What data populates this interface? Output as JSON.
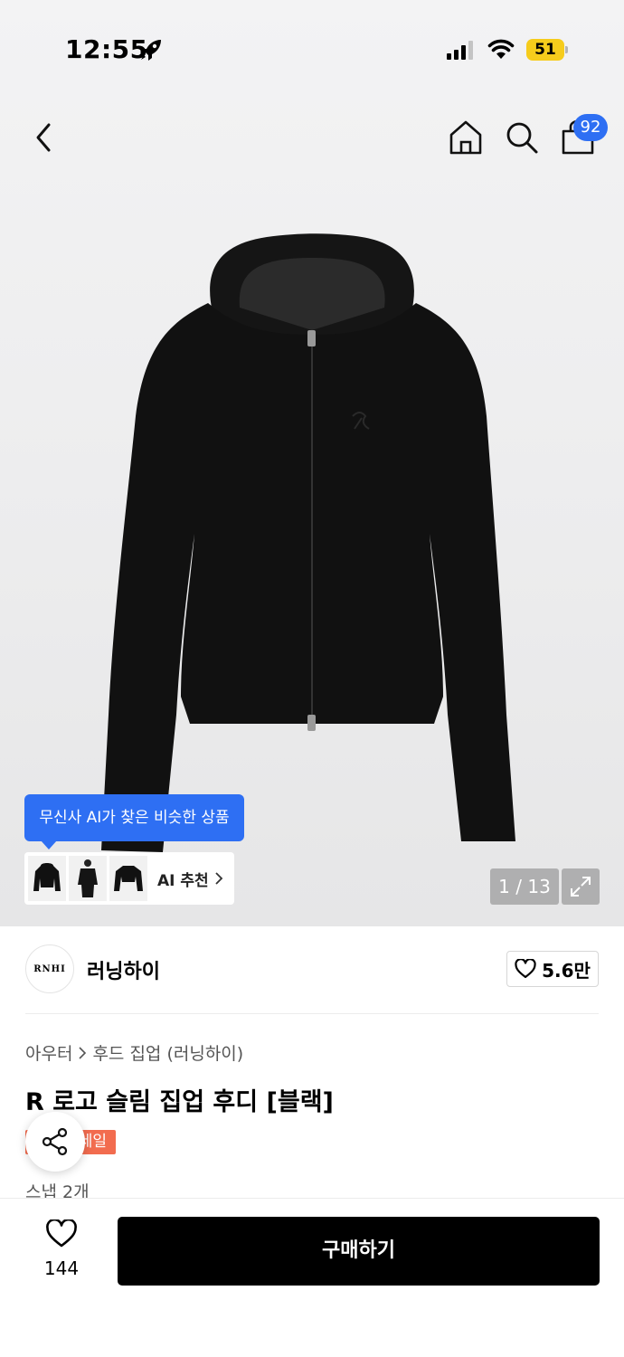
{
  "status_bar": {
    "time": "12:55",
    "battery": "51"
  },
  "nav": {
    "cart_count": "92"
  },
  "ai": {
    "tooltip": "무신사 AI가 찾은 비슷한 상품",
    "reco_label": "AI 추천"
  },
  "gallery": {
    "counter": "1 / 13"
  },
  "brand": {
    "logo_text": "RNHI",
    "name": "러닝하이",
    "likes": "5.6만"
  },
  "breadcrumb": {
    "category": "아우터",
    "subcategory": "후드 집업 (러닝하이)"
  },
  "product": {
    "title": "R 로고 슬림 집업 후디 [블랙]",
    "sale_tag": "세일",
    "snap": "스냅 2개"
  },
  "bottom_bar": {
    "like_count": "144",
    "buy_label": "구매하기"
  },
  "colors": {
    "accent_blue": "#2e6ff3",
    "sale_orange": "#f26c4f",
    "battery_yellow": "#f6cc1c"
  },
  "icons": [
    "rocket-icon",
    "signal-icon",
    "wifi-icon",
    "back-icon",
    "home-icon",
    "search-icon",
    "bag-icon",
    "chevron-right-icon",
    "expand-icon",
    "heart-icon",
    "share-icon"
  ]
}
